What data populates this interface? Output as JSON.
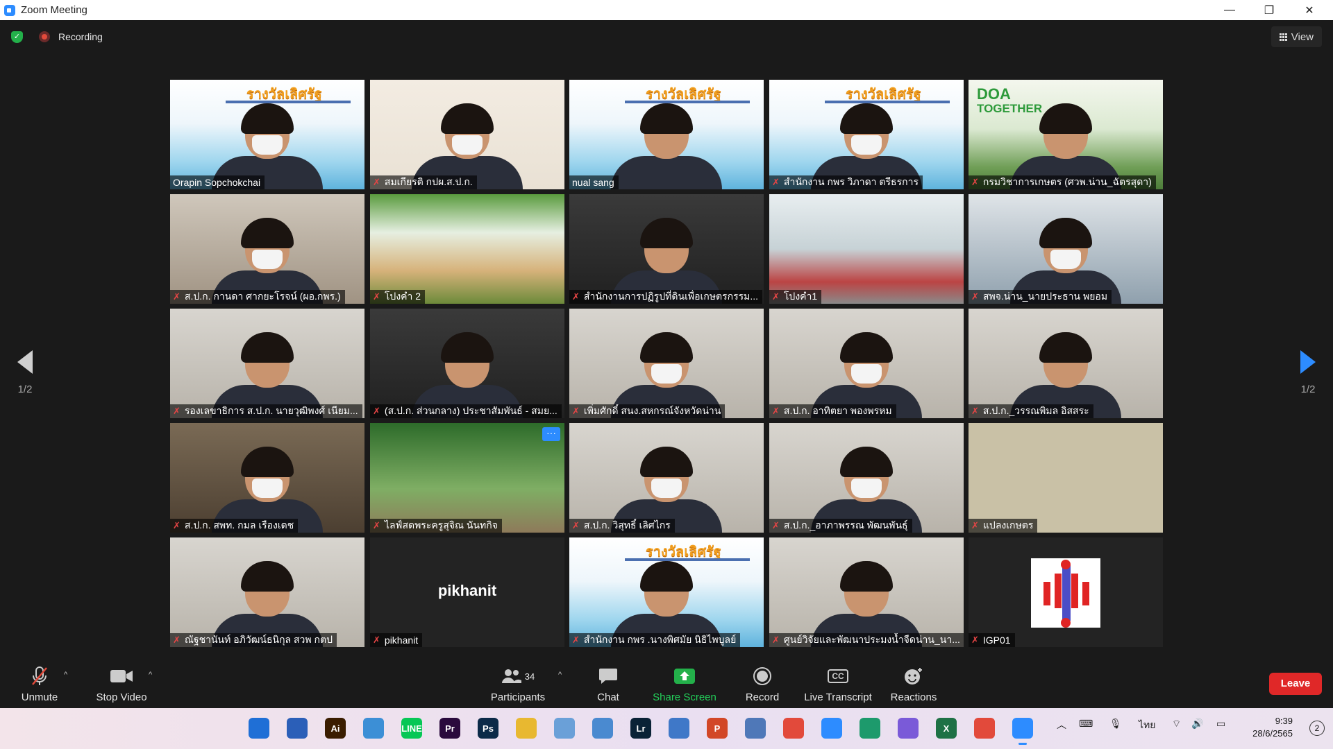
{
  "window": {
    "title": "Zoom Meeting",
    "controls": [
      "—",
      "❐",
      "✕"
    ]
  },
  "top": {
    "recording_label": "Recording",
    "view_label": "View"
  },
  "pager": {
    "left_page": "1/2",
    "right_page": "1/2"
  },
  "participants": [
    {
      "name": "Orapin Sopchokchai",
      "muted": false,
      "bg": "banner",
      "banner_text": "รางวัลเลิศรัฐ"
    },
    {
      "name": "สมเกียรติ กปผ.ส.ป.ก.",
      "muted": true,
      "bg": "cream"
    },
    {
      "name": "nual sang",
      "muted": false,
      "bg": "banner",
      "banner_text": "รางวัลเลิศรัฐ"
    },
    {
      "name": "สำนักงาน กพร วิภาดา ตรีธรการ",
      "muted": true,
      "bg": "banner",
      "banner_text": "รางวัลเลิศรัฐ"
    },
    {
      "name": "กรมวิชาการเกษตร (ศวพ.น่าน_ฉัตรสุดา)",
      "muted": true,
      "bg": "doa",
      "banner_text": "DOA",
      "banner_text2": "TOGETHER"
    },
    {
      "name": "ส.ป.ก. กานดา ศากยะโรจน์ (ผอ.กพร.)",
      "muted": true,
      "bg": "room"
    },
    {
      "name": "โปงคำ 2",
      "muted": true,
      "bg": "poster",
      "active": true
    },
    {
      "name": "สำนักงานการปฏิรูปที่ดินเพื่อเกษตรกรรม...",
      "muted": true,
      "bg": "dark"
    },
    {
      "name": "โปงคำ1",
      "muted": true,
      "bg": "meeting"
    },
    {
      "name": "สพจ.น่าน_นายประธาน พยอม",
      "muted": true,
      "bg": "blue-office"
    },
    {
      "name": "รองเลขาธิการ ส.ป.ก. นายวุฒิพงศ์ เนียม...",
      "muted": true,
      "bg": "wall"
    },
    {
      "name": "(ส.ป.ก. ส่วนกลาง) ประชาสัมพันธ์ - สมย...",
      "muted": true,
      "bg": "dark"
    },
    {
      "name": "เพิ่มศักดิ์ สนง.สหกรณ์จังหวัดน่าน",
      "muted": true,
      "bg": "wall"
    },
    {
      "name": "ส.ป.ก. อาทิตยา พองพรหม",
      "muted": true,
      "bg": "wall"
    },
    {
      "name": "ส.ป.ก._วรรณพิมล อิสสระ",
      "muted": true,
      "bg": "wall"
    },
    {
      "name": "ส.ป.ก. สพท. กมล เรืองเดช",
      "muted": true,
      "bg": "office"
    },
    {
      "name": "ไลฟ์สดพระครูสุจิณ นันทกิจ",
      "muted": true,
      "bg": "green",
      "more": "···"
    },
    {
      "name": "ส.ป.ก. วิสุทธิ์ เลิศไกร",
      "muted": true,
      "bg": "wall"
    },
    {
      "name": "ส.ป.ก._อาภาพรรณ พัฒนพันธุ์",
      "muted": true,
      "bg": "wall"
    },
    {
      "name": "แปลงเกษตร",
      "muted": true,
      "bg": "beige"
    },
    {
      "name": "ณัฐชานันท์ อภิวัฒน์ธนิกุล สวพ กตป",
      "muted": true,
      "bg": "wall"
    },
    {
      "name": "pikhanit",
      "muted": true,
      "bg": "black",
      "big_name": "pikhanit"
    },
    {
      "name": "สำนักงาน กพร .นางพิศมัย นิธิไพบูลย์",
      "muted": true,
      "bg": "banner",
      "banner_text": "รางวัลเลิศรัฐ"
    },
    {
      "name": "ศูนย์วิจัยและพัฒนาประมงน้ำจืดน่าน_นา...",
      "muted": true,
      "bg": "wall"
    },
    {
      "name": "IGP01",
      "muted": true,
      "bg": "black",
      "logo": true
    }
  ],
  "toolbar": {
    "unmute": "Unmute",
    "stop_video": "Stop Video",
    "participants": "Participants",
    "participants_count": "34",
    "chat": "Chat",
    "share_screen": "Share Screen",
    "record": "Record",
    "live_transcript": "Live Transcript",
    "cc": "CC",
    "reactions": "Reactions",
    "leave": "Leave"
  },
  "taskbar": {
    "apps": [
      {
        "name": "windows-start-icon",
        "label": "",
        "color": "#1f6fd6"
      },
      {
        "name": "store-icon",
        "label": "",
        "color": "#2b5fb8"
      },
      {
        "name": "illustrator-icon",
        "label": "Ai",
        "color": "#3a1d00"
      },
      {
        "name": "photos-icon",
        "label": "",
        "color": "#3c8fd6"
      },
      {
        "name": "line-icon",
        "label": "LINE",
        "color": "#06c755"
      },
      {
        "name": "premiere-icon",
        "label": "Pr",
        "color": "#2a0a3d"
      },
      {
        "name": "photoshop-icon",
        "label": "Ps",
        "color": "#0b2a48"
      },
      {
        "name": "file-explorer-icon",
        "label": "",
        "color": "#e8b830"
      },
      {
        "name": "snipping-icon",
        "label": "",
        "color": "#6aa0d8"
      },
      {
        "name": "crop-tool-icon",
        "label": "",
        "color": "#4a8ad0"
      },
      {
        "name": "lightroom-icon",
        "label": "Lr",
        "color": "#0a2236"
      },
      {
        "name": "world-clock-icon",
        "label": "",
        "color": "#3f78c8"
      },
      {
        "name": "powerpoint-icon",
        "label": "P",
        "color": "#d24726"
      },
      {
        "name": "monitor-icon",
        "label": "",
        "color": "#4f78b8"
      },
      {
        "name": "chrome-icon",
        "label": "",
        "color": "#e24a3b"
      },
      {
        "name": "zoom-icon",
        "label": "",
        "color": "#2d8cff"
      },
      {
        "name": "pen-icon",
        "label": "",
        "color": "#1d9a6c"
      },
      {
        "name": "snip-sketch-icon",
        "label": "",
        "color": "#7a5ad8"
      },
      {
        "name": "excel-icon",
        "label": "X",
        "color": "#1e7145"
      },
      {
        "name": "chrome-profile-icon",
        "label": "",
        "color": "#e24a3b"
      },
      {
        "name": "zoom-active-icon",
        "label": "",
        "color": "#2d8cff"
      }
    ],
    "lang": "ไทย",
    "time": "9:39",
    "date": "28/6/2565",
    "notifications": "2"
  }
}
